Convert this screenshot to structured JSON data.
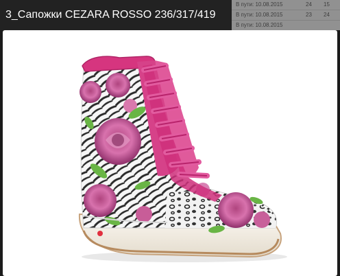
{
  "lightbox": {
    "title": "3_Сапожки CEZARA ROSSO 236/317/419",
    "image_alt": "Сапожки CEZARA ROSSO"
  },
  "background_table": {
    "rows": [
      {
        "status": "В пути: 10.08.2015",
        "qty": "24",
        "extra": "15"
      },
      {
        "status": "В пути: 10.08.2015",
        "qty": "23",
        "extra": "24"
      },
      {
        "status": "В пути: 10.08.2015",
        "qty": "",
        "extra": ""
      }
    ]
  }
}
